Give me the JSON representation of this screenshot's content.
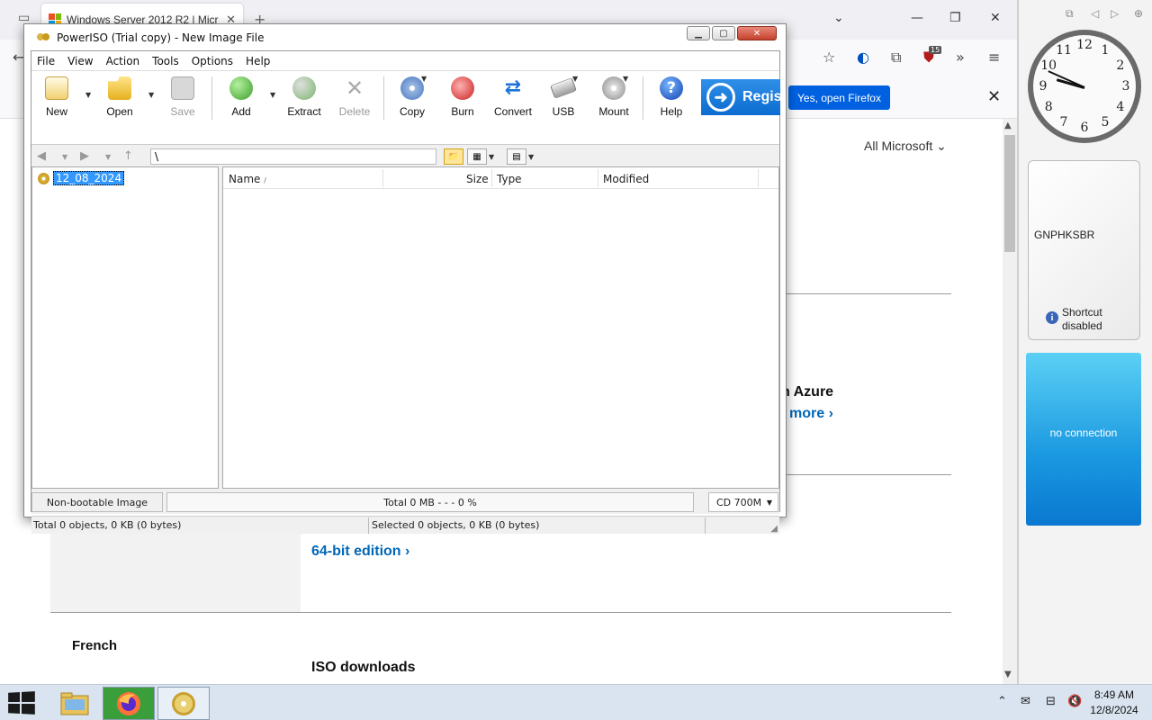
{
  "browser": {
    "tab_title": "Windows Server 2012 R2 | Micr",
    "notification_button": "Yes, open Firefox",
    "extension_badge": "15"
  },
  "page": {
    "all_microsoft": "All Microsoft",
    "azure_fragment": "n Azure",
    "more_link": "more",
    "iso_downloads_1": "ISO downloads",
    "edition_link": "64-bit edition",
    "french": "French",
    "iso_downloads_2": "ISO downloads"
  },
  "gadgets": {
    "clock_numbers": [
      "12",
      "1",
      "2",
      "3",
      "4",
      "5",
      "6",
      "7",
      "8",
      "9",
      "10",
      "11"
    ],
    "note_text": "GNPHKSBR",
    "shortcut_text": "Shortcut disabled",
    "weather_text": "no connection"
  },
  "poweriso": {
    "title": "PowerISO (Trial copy) - New Image File",
    "menu": [
      "File",
      "View",
      "Action",
      "Tools",
      "Options",
      "Help"
    ],
    "toolbar": {
      "new": "New",
      "open": "Open",
      "save": "Save",
      "add": "Add",
      "extract": "Extract",
      "delete": "Delete",
      "copy": "Copy",
      "burn": "Burn",
      "convert": "Convert",
      "usb": "USB",
      "mount": "Mount",
      "help": "Help",
      "register": "Regis"
    },
    "address": "\\",
    "tree_root": "12_08_2024",
    "columns": {
      "name": "Name",
      "size": "Size",
      "type": "Type",
      "modified": "Modified"
    },
    "status": {
      "boot": "Non-bootable Image",
      "progress": "Total  0 MB   - - -  0 %",
      "capacity": "CD 700M",
      "total": "Total 0 objects, 0 KB (0 bytes)",
      "selected": "Selected 0 objects, 0 KB (0 bytes)"
    }
  },
  "taskbar": {
    "time": "8:49 AM",
    "date": "12/8/2024"
  },
  "colors": {
    "ms_link": "#0067b8",
    "firefox_button": "#0061e0",
    "register_bg": "#0c6cd0",
    "tree_selection": "#3399ff"
  }
}
